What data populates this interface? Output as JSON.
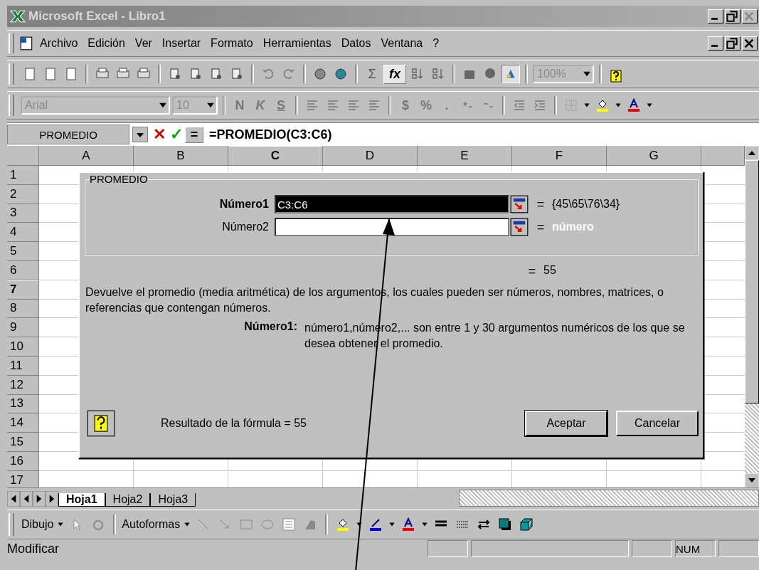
{
  "window": {
    "title": "Microsoft Excel - Libro1"
  },
  "menu": [
    {
      "label": "Archivo"
    },
    {
      "label": "Edición"
    },
    {
      "label": "Ver"
    },
    {
      "label": "Insertar"
    },
    {
      "label": "Formato"
    },
    {
      "label": "Herramientas"
    },
    {
      "label": "Datos"
    },
    {
      "label": "Ventana"
    },
    {
      "label": "?"
    }
  ],
  "standard_toolbar": {
    "sum": "Σ",
    "function": "fx",
    "zoom": "100%"
  },
  "format_toolbar": {
    "font": "Arial",
    "size": "10",
    "styles": [
      "N",
      "K",
      "S"
    ],
    "currency": "$",
    "percent": "%",
    "thousands": "."
  },
  "formula_bar": {
    "name_box": "PROMEDIO",
    "cancel": "✕",
    "enter": "✓",
    "equals": "=",
    "formula": "=PROMEDIO(C3:C6)"
  },
  "columns": [
    {
      "label": "A",
      "selected": false
    },
    {
      "label": "B",
      "selected": false
    },
    {
      "label": "C",
      "selected": true
    },
    {
      "label": "D",
      "selected": false
    },
    {
      "label": "E",
      "selected": false
    },
    {
      "label": "F",
      "selected": false
    },
    {
      "label": "G",
      "selected": false
    }
  ],
  "rows": [
    {
      "label": "1",
      "selected": false
    },
    {
      "label": "2",
      "selected": false
    },
    {
      "label": "3",
      "selected": false
    },
    {
      "label": "4",
      "selected": false
    },
    {
      "label": "5",
      "selected": false
    },
    {
      "label": "6",
      "selected": false
    },
    {
      "label": "7",
      "selected": true
    },
    {
      "label": "8",
      "selected": false
    },
    {
      "label": "9",
      "selected": false
    },
    {
      "label": "10",
      "selected": false
    },
    {
      "label": "11",
      "selected": false
    },
    {
      "label": "12",
      "selected": false
    },
    {
      "label": "13",
      "selected": false
    },
    {
      "label": "14",
      "selected": false
    },
    {
      "label": "15",
      "selected": false
    },
    {
      "label": "16",
      "selected": false
    },
    {
      "label": "17",
      "selected": false
    }
  ],
  "dialog": {
    "group": "PROMEDIO",
    "arguments": [
      {
        "label": "Número1",
        "value": "C3:C6",
        "selected": true,
        "eq": "=",
        "result": "{45\\65\\76\\34}",
        "result_dimmed": false
      },
      {
        "label": "Número2",
        "selected": false,
        "eq": "=",
        "result": "número",
        "result_dimmed": true
      }
    ],
    "total_eq": "=",
    "total": "55",
    "description": "Devuelve el promedio (media aritmética) de los argumentos, los cuales pueden ser números, nombres, matrices, o referencias que contengan números.",
    "arg_label": "Número1:",
    "arg_help": "número1,número2,... son entre 1 y 30 argumentos numéricos de los que se desea obtener el promedio.",
    "formula_result": "Resultado de la fórmula = 55",
    "buttons": [
      "Aceptar",
      "Cancelar"
    ]
  },
  "sheet_tabs": [
    {
      "label": "Hoja1",
      "selected": true
    },
    {
      "label": "Hoja2",
      "selected": false
    },
    {
      "label": "Hoja3",
      "selected": false
    }
  ],
  "drawing_toolbar": {
    "draw": "Dibujo",
    "autoshapes": "Autoformas"
  },
  "status_bar": {
    "mode": "Modificar",
    "num": "NUM"
  }
}
